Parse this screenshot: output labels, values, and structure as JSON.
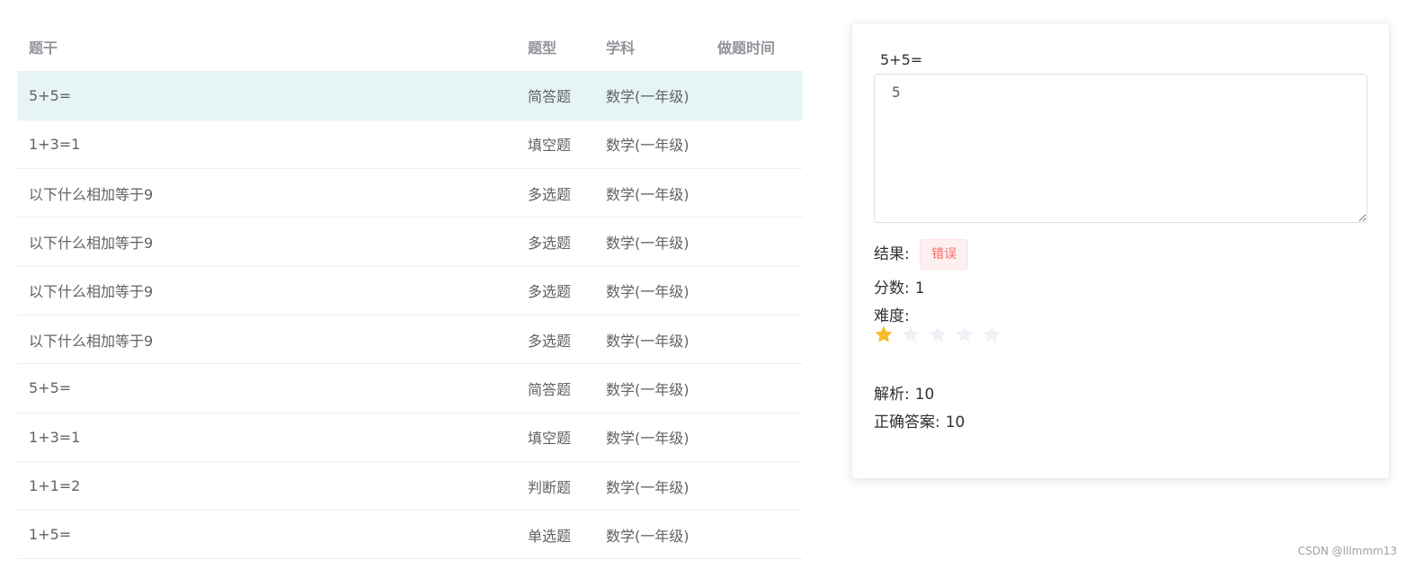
{
  "table": {
    "headers": {
      "stem": "题干",
      "type": "题型",
      "subject": "学科",
      "time": "做题时间"
    },
    "rows": [
      {
        "stem": "5+5=",
        "type": "简答题",
        "subject": "数学(一年级)",
        "time": ""
      },
      {
        "stem": "1+3=1",
        "type": "填空题",
        "subject": "数学(一年级)",
        "time": ""
      },
      {
        "stem": "以下什么相加等于9",
        "type": "多选题",
        "subject": "数学(一年级)",
        "time": ""
      },
      {
        "stem": "以下什么相加等于9",
        "type": "多选题",
        "subject": "数学(一年级)",
        "time": ""
      },
      {
        "stem": "以下什么相加等于9",
        "type": "多选题",
        "subject": "数学(一年级)",
        "time": ""
      },
      {
        "stem": "以下什么相加等于9",
        "type": "多选题",
        "subject": "数学(一年级)",
        "time": ""
      },
      {
        "stem": "5+5=",
        "type": "简答题",
        "subject": "数学(一年级)",
        "time": ""
      },
      {
        "stem": "1+3=1",
        "type": "填空题",
        "subject": "数学(一年级)",
        "time": ""
      },
      {
        "stem": "1+1=2",
        "type": "判断题",
        "subject": "数学(一年级)",
        "time": ""
      },
      {
        "stem": "1+5=",
        "type": "单选题",
        "subject": "数学(一年级)",
        "time": ""
      }
    ],
    "selected_row": 0
  },
  "detail": {
    "question": "5+5=",
    "answer_value": "5",
    "result_label": "结果:",
    "result_tag": "错误",
    "score_label": "分数:",
    "score_value": "1",
    "difficulty_label": "难度:",
    "difficulty_rating": 1,
    "difficulty_max": 5,
    "analysis_label": "解析:",
    "analysis_value": "10",
    "correct_label": "正确答案:",
    "correct_value": "10"
  },
  "colors": {
    "selected_row_bg": "#e6f5f4",
    "star_on": "#f7ba2a",
    "star_off": "#eef1f6",
    "error_text": "#f56c6c"
  },
  "icons": [
    "star-icon",
    "resize-handle-icon"
  ],
  "footer": {
    "credit": "CSDN @lllmmm13"
  }
}
